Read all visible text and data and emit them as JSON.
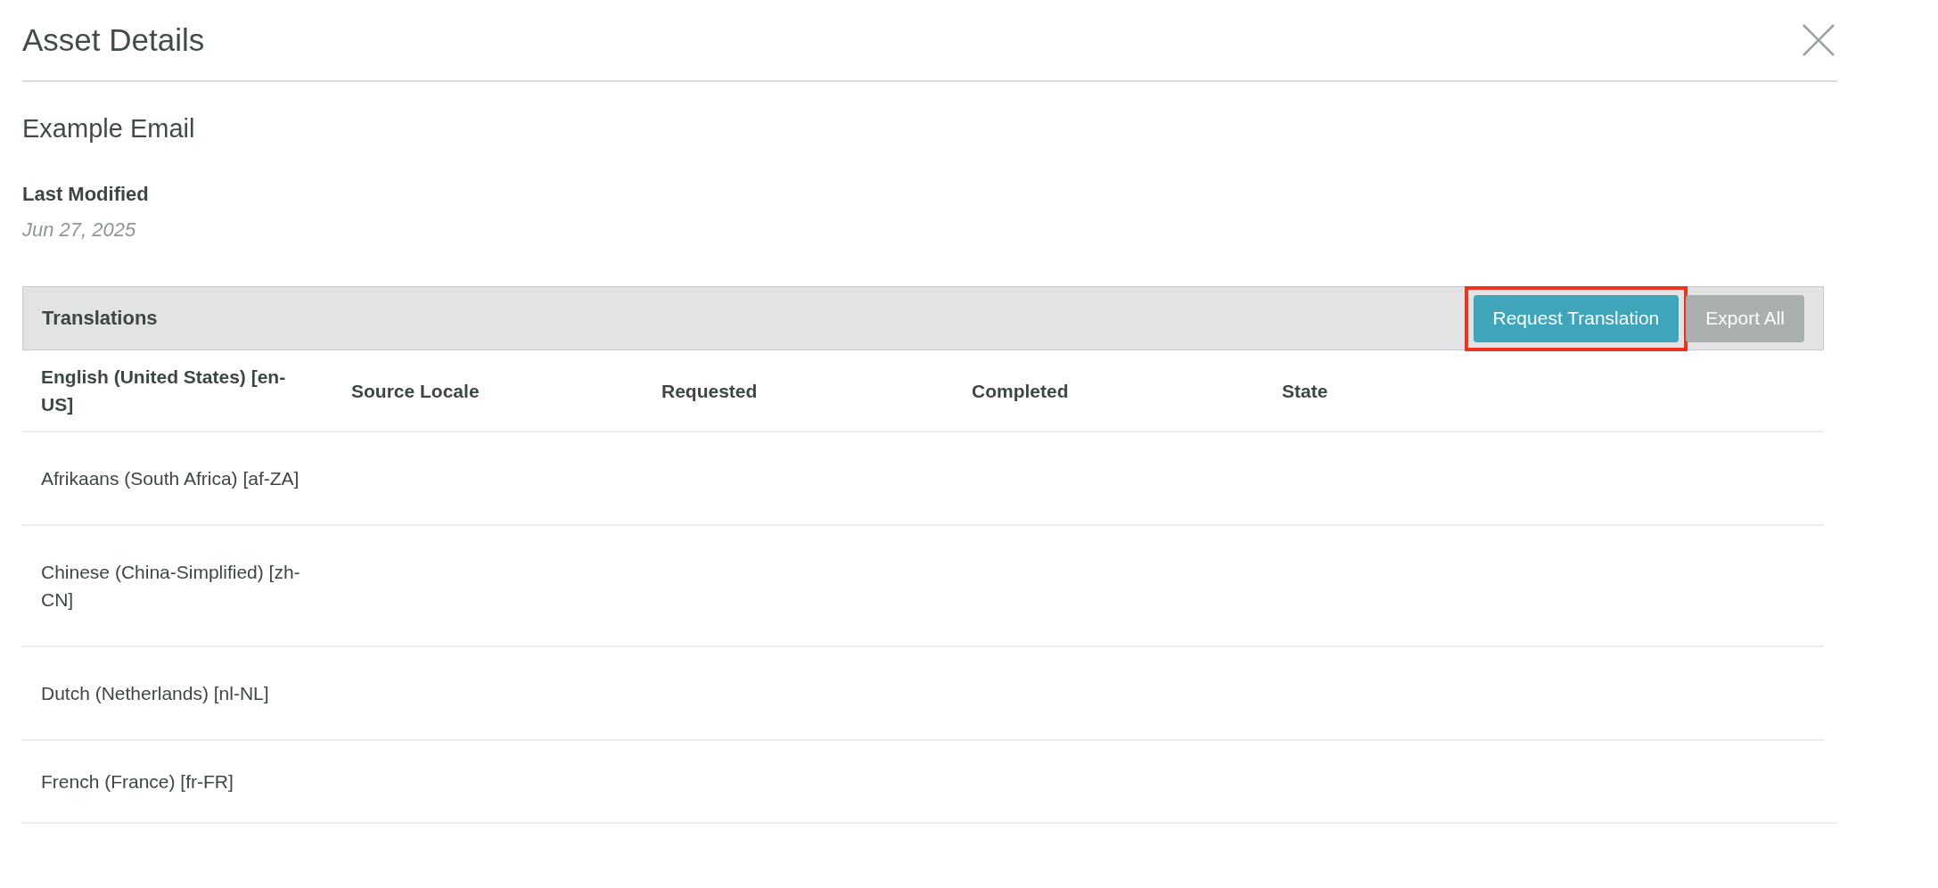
{
  "dialog": {
    "title": "Asset Details"
  },
  "asset": {
    "name": "Example Email",
    "last_modified_label": "Last Modified",
    "last_modified": "Jun 27, 2025"
  },
  "translations": {
    "title": "Translations",
    "buttons": [
      {
        "label": "Request Translation",
        "kind": "primary",
        "highlighted": true
      },
      {
        "label": "Export All",
        "kind": "secondary",
        "highlighted": false
      }
    ],
    "table": {
      "columns": [
        "English (United States) [en-US]",
        "Source Locale",
        "Requested",
        "Completed",
        "State"
      ],
      "rows": [
        {
          "locale": "Afrikaans (South Africa) [af-ZA]"
        },
        {
          "locale": "Chinese (China-Simplified) [zh-CN]"
        },
        {
          "locale": "Dutch (Netherlands) [nl-NL]"
        },
        {
          "locale": "French (France) [fr-FR]"
        }
      ]
    }
  }
}
